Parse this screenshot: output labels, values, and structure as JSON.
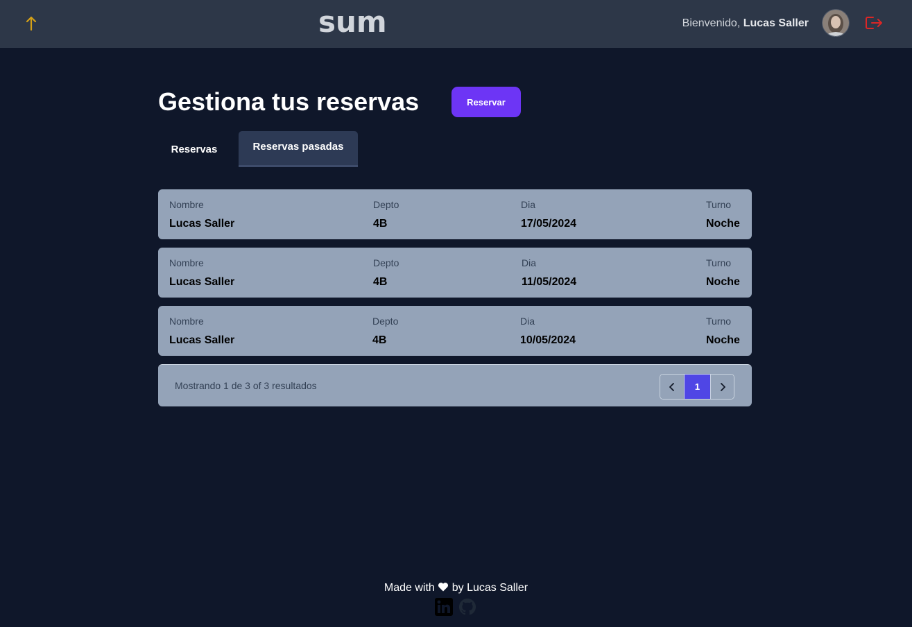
{
  "header": {
    "logo": "sum",
    "welcome_prefix": "Bienvenido, ",
    "user_name": "Lucas Saller",
    "colors": {
      "bar": "#2d3748",
      "up_arrow": "#d4a017",
      "logout": "#dc2626"
    }
  },
  "main": {
    "title": "Gestiona tus reservas",
    "reserve_button": "Reservar",
    "tabs": [
      {
        "label": "Reservas",
        "active": false
      },
      {
        "label": "Reservas pasadas",
        "active": true
      }
    ],
    "column_labels": {
      "name": "Nombre",
      "apt": "Depto",
      "day": "Dia",
      "shift": "Turno"
    },
    "reservations": [
      {
        "name": "Lucas Saller",
        "apt": "4B",
        "day": "17/05/2024",
        "shift": "Noche"
      },
      {
        "name": "Lucas Saller",
        "apt": "4B",
        "day": "11/05/2024",
        "shift": "Noche"
      },
      {
        "name": "Lucas Saller",
        "apt": "4B",
        "day": "10/05/2024",
        "shift": "Noche"
      }
    ],
    "pagination": {
      "summary": "Mostrando 1 de 3 of 3 resultados",
      "current_page": "1"
    }
  },
  "footer": {
    "made_with_prefix": "Made with",
    "made_with_suffix": "by Lucas Saller",
    "icons": [
      "linkedin-icon",
      "github-icon"
    ]
  },
  "colors": {
    "page_bg": "#0f172a",
    "card_bg": "#94a3b8",
    "accent_button": "#6d35f5",
    "page_active": "#4f46e5"
  }
}
